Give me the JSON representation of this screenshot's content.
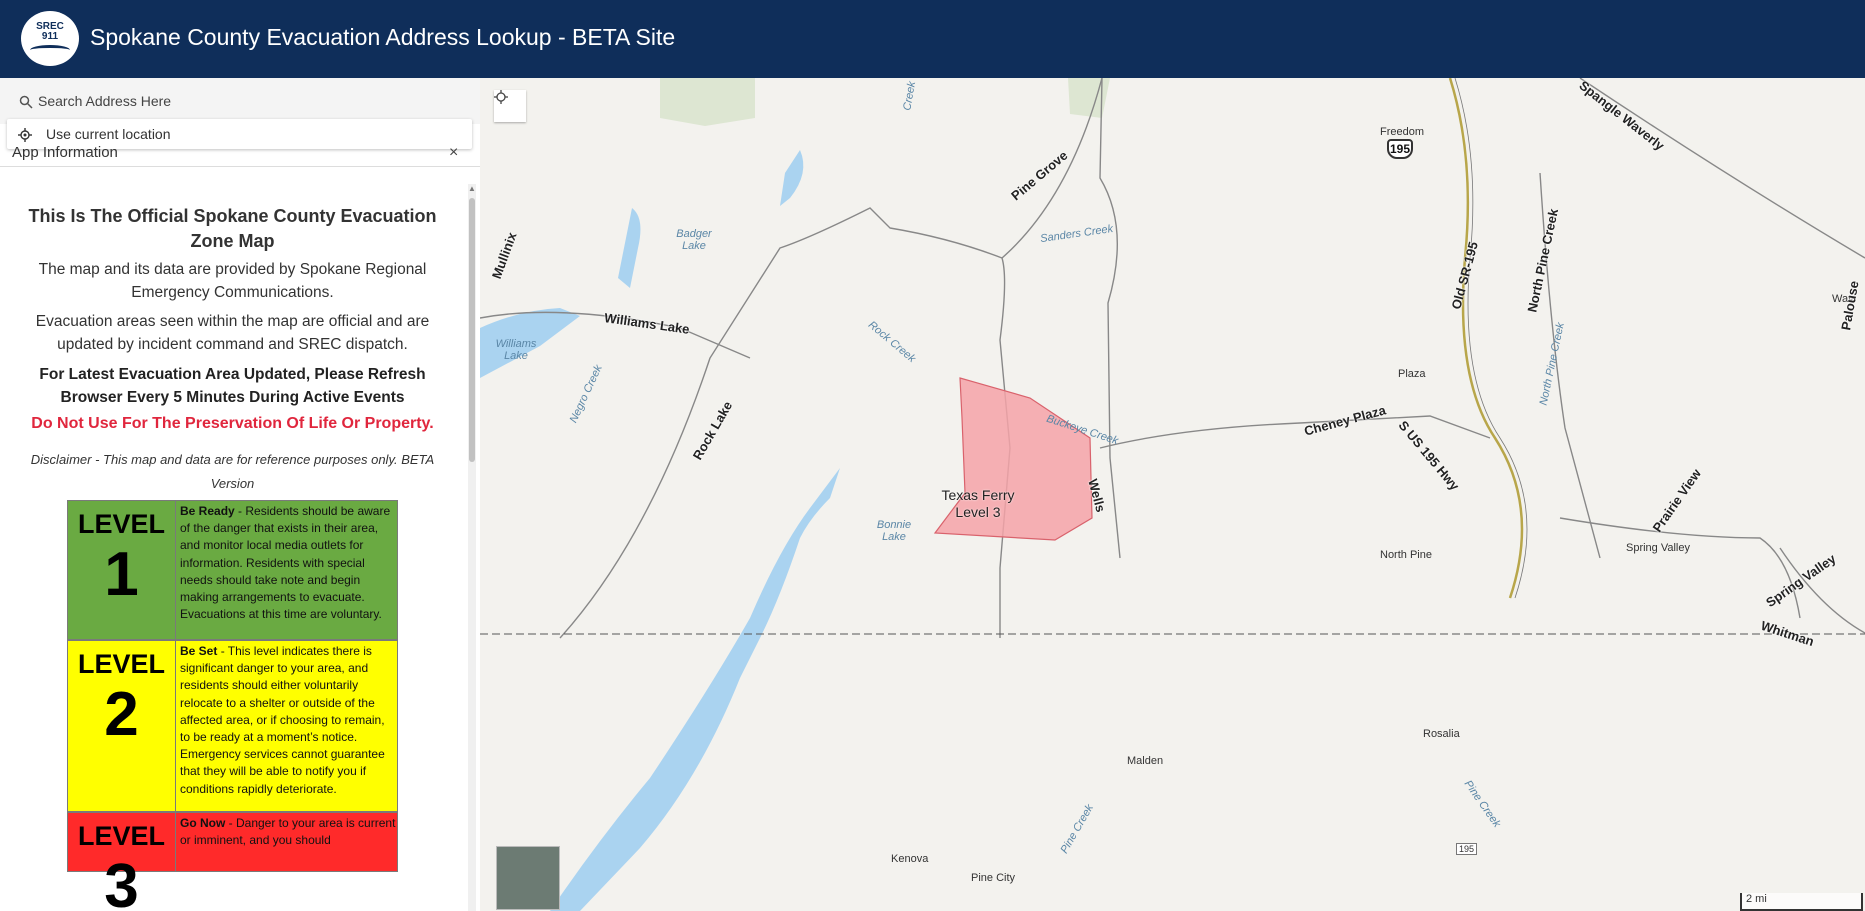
{
  "header": {
    "logo_text": "SREC",
    "logo_sub": "911",
    "title": "Spokane County Evacuation Address Lookup - BETA Site"
  },
  "search": {
    "placeholder": "Search Address Here",
    "suggestion": "Use current location"
  },
  "panel": {
    "title": "App Information",
    "close": "×",
    "heading": "This Is The Official Spokane County Evacuation Zone Map",
    "p1": "The map and its data are provided by Spokane Regional Emergency Communications.",
    "p2": "Evacuation areas seen within the map are official and are updated by incident command and SREC dispatch.",
    "p3": "For Latest Evacuation Area Updated, Please Refresh Browser Every 5 Minutes During Active Events",
    "warning": "Do Not Use For The Preservation Of Life Or Property.",
    "disclaimer": "Disclaimer - This map and data are for reference purposes only. BETA Version"
  },
  "levels": [
    {
      "word": "LEVEL",
      "number": "1",
      "color": "#6aaa42",
      "title": "Be Ready",
      "text": " - Residents should be aware of the danger that exists in their area, and monitor local media outlets for information. Residents with special needs should take note and begin making arrangements to evacuate.  Evacuations at this time are voluntary."
    },
    {
      "word": "LEVEL",
      "number": "2",
      "color": "#ffff00",
      "title": "Be Set",
      "text": " - This level indicates there is significant danger to your area, and residents should either voluntarily relocate to a shelter or outside of the affected area, or if choosing to remain, to be ready at a moment’s notice.  Emergency services cannot guarantee that they will be able to notify you if conditions rapidly deteriorate."
    },
    {
      "word": "LEVEL",
      "number": "3",
      "color": "#ff2a2a",
      "title": "Go Now",
      "text": " - Danger to your area is current or imminent, and you should"
    }
  ],
  "map": {
    "zone_label_line1": "Texas Ferry",
    "zone_label_line2": "Level 3",
    "scale": "2 mi",
    "labels": {
      "pine_grove": "Pine Grove",
      "sanders_creek": "Sanders Creek",
      "badger_lake": "Badger Lake",
      "mullinix": "Mullinix",
      "williams_lake_road": "Williams Lake",
      "williams_lake": "Williams Lake",
      "negro_creek": "Negro Creek",
      "rock_lake": "Rock Lake",
      "rock_creek": "Rock Creek",
      "buckeye_creek": "Buckeye Creek",
      "bonnie_lake": "Bonnie Lake",
      "wells": "Wells",
      "freedom": "Freedom",
      "us195": "195",
      "old_sr195": "Old SR-195",
      "north_pine_creek": "North Pine Creek",
      "north_pine_creek_water": "North Pine Creek",
      "spangle_waverly": "Spangle Waverly",
      "plaza": "Plaza",
      "cheney_plaza": "Cheney Plaza",
      "s_us195_hwy": "S US 195 Hwy",
      "north_pine": "North Pine",
      "prairie_view": "Prairie View",
      "spring_valley_place": "Spring Valley",
      "spring_valley_road": "Spring Valley",
      "whitman": "Whitman",
      "waverly": "Wav",
      "palouse": "Palouse",
      "rosalia": "Rosalia",
      "malden": "Malden",
      "kenova": "Kenova",
      "pine_city": "Pine City",
      "pine_creek_1": "Pine Creek",
      "pine_creek_2": "Pine Creek",
      "creek_top": "Creek",
      "hwy195_small": "195"
    }
  }
}
